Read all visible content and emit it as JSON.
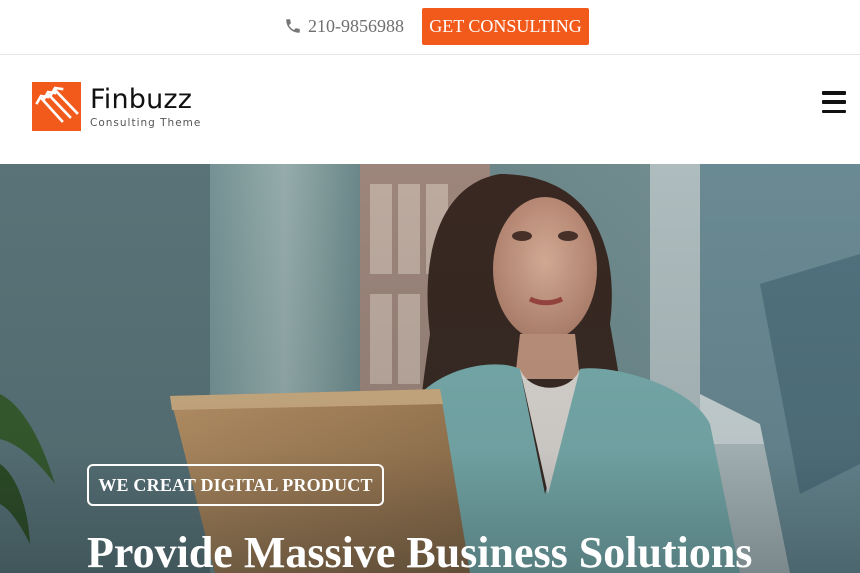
{
  "topbar": {
    "phone": "210-9856988",
    "cta_label": "GET CONSULTING"
  },
  "header": {
    "logo_name": "Finbuzz",
    "logo_tagline": "Consulting Theme",
    "menu_icon": "hamburger-menu-icon"
  },
  "hero": {
    "badge": "WE CREAT DIGITAL PRODUCT",
    "title": "Provide Massive Business Solutions"
  },
  "colors": {
    "accent": "#f25a1c",
    "text_dark": "#111111",
    "text_muted": "#6f6f6f",
    "white": "#ffffff"
  },
  "icons": [
    "phone-icon",
    "finbuzz-logo-icon",
    "hamburger-menu-icon"
  ]
}
